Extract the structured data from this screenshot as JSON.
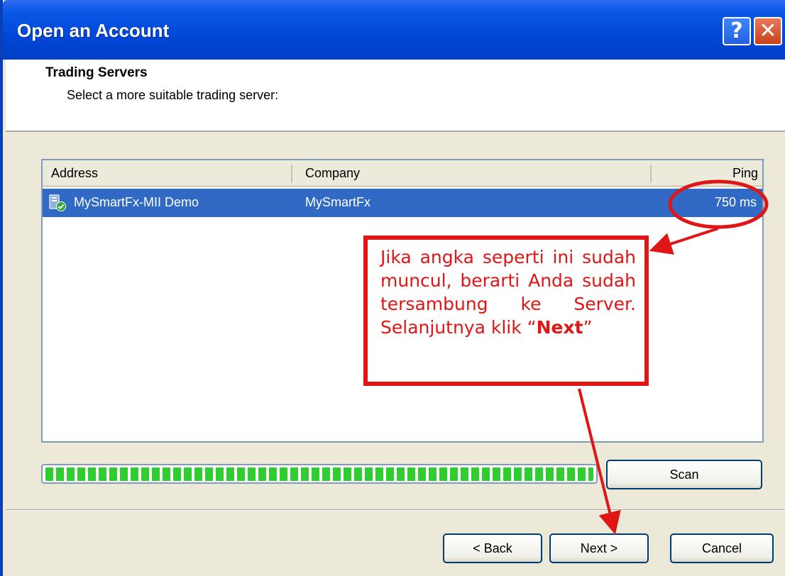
{
  "window": {
    "title": "Open an Account",
    "help_label": "?",
    "close_label": "✕"
  },
  "header": {
    "title": "Trading Servers",
    "subtitle": "Select a more suitable trading server:"
  },
  "servers_table": {
    "columns": [
      "Address",
      "Company",
      "Ping"
    ],
    "rows": [
      {
        "address": "MySmartFx-MII Demo",
        "company": "MySmartFx",
        "ping": "750 ms",
        "icon": "server-connected-icon",
        "selected": true
      }
    ]
  },
  "progress": {
    "value": 1.0,
    "color": "#2fcd2f"
  },
  "buttons": {
    "scan": "Scan",
    "back": "< Back",
    "next": "Next >",
    "cancel": "Cancel"
  },
  "annotation": {
    "text_before": "Jika angka seperti ini sudah muncul, berarti Anda sudah tersambung ke Server. Selanjutnya klik “",
    "text_bold": "Next",
    "text_after": "”",
    "color": "#e01515"
  },
  "colors": {
    "titlebar": "#0047d8",
    "selection": "#316ac5",
    "dialog_bg": "#ece9d8"
  }
}
